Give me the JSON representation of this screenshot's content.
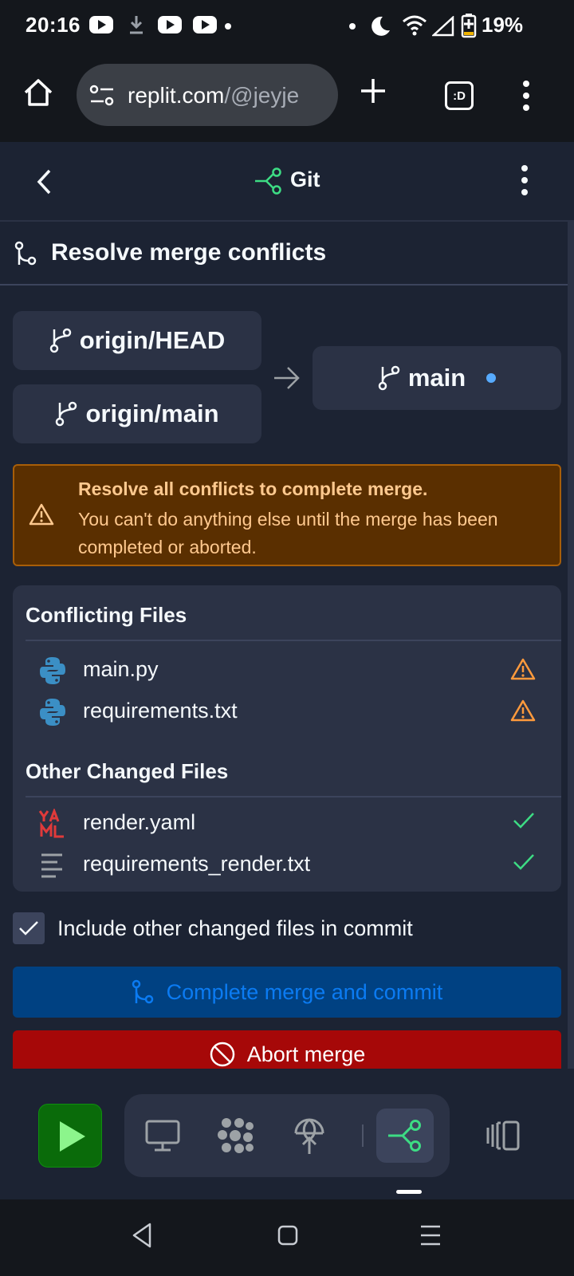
{
  "status_bar": {
    "time": "20:16",
    "battery": "19%"
  },
  "browser": {
    "url_main": "replit.com",
    "url_path": "/@jeyje",
    "tab_badge": ":D"
  },
  "header": {
    "title": "Git"
  },
  "merge": {
    "title": "Resolve merge conflicts",
    "source_branches": [
      "origin/HEAD",
      "origin/main"
    ],
    "target_branch": "main"
  },
  "warning": {
    "title": "Resolve all conflicts to complete merge.",
    "body": "You can't do anything else until the merge has been completed or aborted."
  },
  "conflicting": {
    "heading": "Conflicting Files",
    "files": [
      {
        "name": "main.py",
        "icon": "python-icon",
        "status": "warning"
      },
      {
        "name": "requirements.txt",
        "icon": "python-icon",
        "status": "warning"
      }
    ]
  },
  "other_changed": {
    "heading": "Other Changed Files",
    "files": [
      {
        "name": "render.yaml",
        "icon": "yaml-icon",
        "status": "ok"
      },
      {
        "name": "requirements_render.txt",
        "icon": "text-file-icon",
        "status": "ok"
      }
    ]
  },
  "include_checkbox": {
    "label": "Include other changed files in commit",
    "checked": true
  },
  "buttons": {
    "commit": "Complete merge and commit",
    "abort": "Abort merge"
  },
  "colors": {
    "background": "#1c2333",
    "surface": "#2b3245",
    "warning_bg": "#5a2f00",
    "warning_text": "#ffc98f",
    "commit_bg": "#004182",
    "commit_text": "#0b7bf2",
    "abort_bg": "#a60808",
    "git_green": "#3ddc84",
    "run_green": "#0a6b0a"
  }
}
